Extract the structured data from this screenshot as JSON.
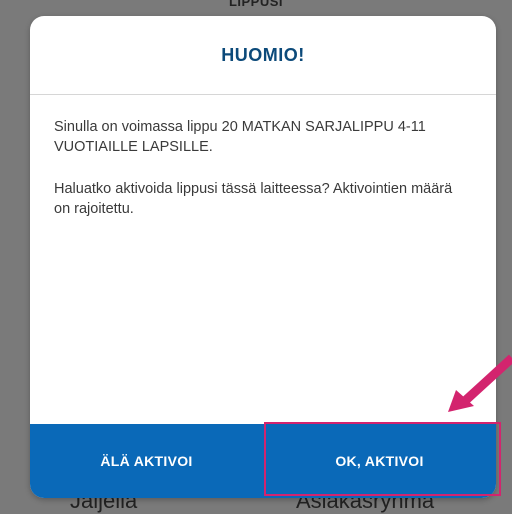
{
  "background": {
    "header_text": "LIPPUSI",
    "bottom_left_text": "Jäljellä",
    "bottom_right_text": "Asiakasryhmä"
  },
  "dialog": {
    "title": "HUOMIO!",
    "message_1": "Sinulla on voimassa lippu 20 MATKAN SARJALIPPU 4-11 VUOTIAILLE LAPSILLE.",
    "message_2": "Haluatko aktivoida lippusi tässä laitteessa? Aktivointien määrä on rajoitettu.",
    "cancel_label": "ÄLÄ AKTIVOI",
    "confirm_label": "OK, AKTIVOI"
  },
  "colors": {
    "title": "#0c4a7a",
    "button_bar": "#0a69b8",
    "highlight": "#d3246e",
    "overlay": "#7a7a7a"
  },
  "icons": {
    "annotation": "arrow-pointer-icon"
  }
}
